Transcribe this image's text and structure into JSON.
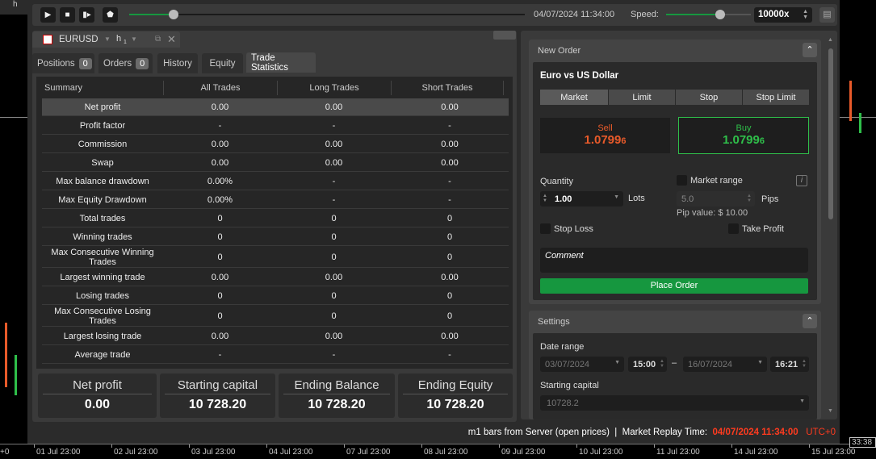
{
  "chart_header": {
    "timeframe": "h",
    "timeframe_sub": "1"
  },
  "toolbar": {
    "datetime": "04/07/2024 11:34:00",
    "speed_label": "Speed:",
    "speed_value": "10000x",
    "progress": 0.05,
    "speed_level": 0.78
  },
  "chart_tab": {
    "symbol": "EURUSD",
    "timeframe": "h",
    "timeframe_sub": "1"
  },
  "tabs": [
    {
      "label": "Positions",
      "badge": "0"
    },
    {
      "label": "Orders",
      "badge": "0"
    },
    {
      "label": "History"
    },
    {
      "label": "Equity"
    },
    {
      "label": "Trade Statistics",
      "active": true
    }
  ],
  "table": {
    "headers": [
      "Summary",
      "All Trades",
      "Long Trades",
      "Short Trades"
    ],
    "rows": [
      [
        "Net profit",
        "0.00",
        "0.00",
        "0.00"
      ],
      [
        "Profit factor",
        "-",
        "-",
        "-"
      ],
      [
        "Commission",
        "0.00",
        "0.00",
        "0.00"
      ],
      [
        "Swap",
        "0.00",
        "0.00",
        "0.00"
      ],
      [
        "Max balance drawdown",
        "0.00%",
        "-",
        "-"
      ],
      [
        "Max Equity Drawdown",
        "0.00%",
        "-",
        "-"
      ],
      [
        "Total trades",
        "0",
        "0",
        "0"
      ],
      [
        "Winning trades",
        "0",
        "0",
        "0"
      ],
      [
        "Max Consecutive Winning Trades",
        "0",
        "0",
        "0"
      ],
      [
        "Largest winning trade",
        "0.00",
        "0.00",
        "0.00"
      ],
      [
        "Losing trades",
        "0",
        "0",
        "0"
      ],
      [
        "Max Consecutive Losing Trades",
        "0",
        "0",
        "0"
      ],
      [
        "Largest losing trade",
        "0.00",
        "0.00",
        "0.00"
      ],
      [
        "Average trade",
        "-",
        "-",
        "-"
      ]
    ]
  },
  "cards": [
    {
      "title": "Net profit",
      "value": "0.00"
    },
    {
      "title": "Starting capital",
      "value": "10 728.20"
    },
    {
      "title": "Ending Balance",
      "value": "10 728.20"
    },
    {
      "title": "Ending Equity",
      "value": "10 728.20"
    }
  ],
  "new_order": {
    "title": "New Order",
    "instrument": "Euro vs US Dollar",
    "order_tabs": [
      "Market",
      "Limit",
      "Stop",
      "Stop Limit"
    ],
    "sell_label": "Sell",
    "sell_price": "1.0799",
    "sell_pip": "6",
    "buy_label": "Buy",
    "buy_price": "1.0799",
    "buy_pip": "6",
    "quantity_label": "Quantity",
    "quantity": "1.00",
    "lots": "Lots",
    "market_range": "Market range",
    "range_value": "5.0",
    "pips": "Pips",
    "pip_value": "Pip value: $ 10.00",
    "stop_loss": "Stop Loss",
    "take_profit": "Take Profit",
    "comment_placeholder": "Comment",
    "place_order": "Place Order"
  },
  "settings": {
    "title": "Settings",
    "date_range_label": "Date range",
    "start_date": "03/07/2024",
    "start_time": "15:00",
    "dash": "–",
    "end_date": "16/07/2024",
    "end_time": "16:21",
    "starting_capital_label": "Starting capital",
    "starting_capital": "10728.2"
  },
  "status": {
    "text": "m1 bars from Server (open prices)  |  Market Replay Time:",
    "time": "04/07/2024 11:34:00",
    "tz": "UTC+0"
  },
  "axis": {
    "labels": [
      "01 Jul 23:00",
      "02 Jul 23:00",
      "03 Jul 23:00",
      "04 Jul 23:00",
      "07 Jul 23:00",
      "08 Jul 23:00",
      "09 Jul 23:00",
      "10 Jul 23:00",
      "11 Jul 23:00",
      "14 Jul 23:00",
      "15 Jul 23:00"
    ],
    "left_label": "+0",
    "clock": "33:38"
  },
  "colors": {
    "sell": "#e85a2a",
    "buy": "#2fbf4a",
    "accent_green": "#16973f",
    "status_time": "#ff3b1f"
  }
}
